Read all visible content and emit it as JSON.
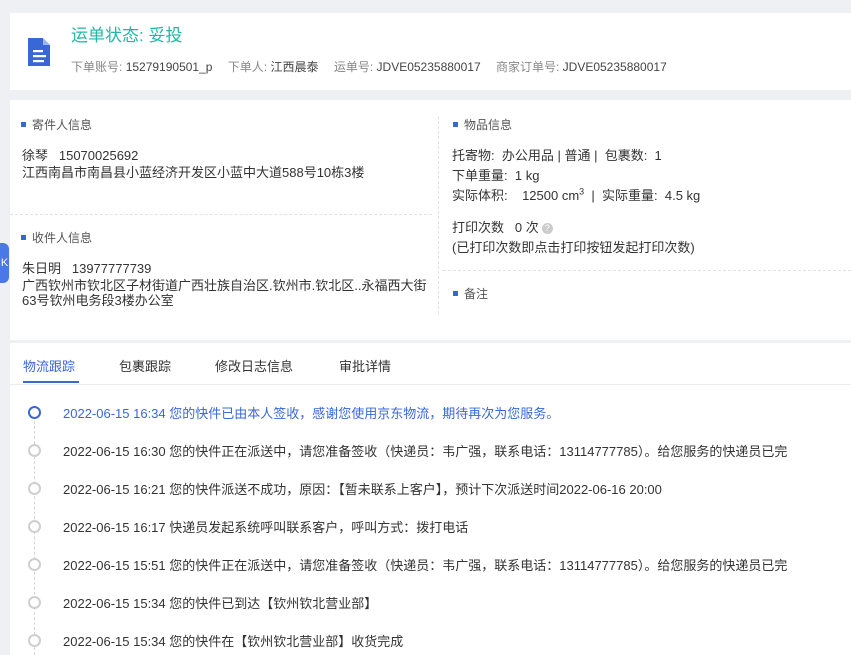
{
  "header": {
    "status": "运单状态: 妥投",
    "account_label": "下单账号:",
    "account_value": "15279190501_p",
    "orderer_label": "下单人:",
    "orderer_value": "江西晨泰",
    "waybill_label": "运单号:",
    "waybill_value": "JDVE05235880017",
    "merchant_label": "商家订单号:",
    "merchant_value": "JDVE05235880017"
  },
  "sender": {
    "title": "寄件人信息",
    "name": "徐琴",
    "phone": "15070025692",
    "address": "江西南昌市南昌县小蓝经济开发区小蓝中大道588号10栋3楼"
  },
  "receiver": {
    "title": "收件人信息",
    "name": "朱日明",
    "phone": "13977777739",
    "address": "广西钦州市钦北区子材街道广西壮族自治区.钦州市.钦北区..永福西大街63号钦州电务段3楼办公室"
  },
  "goods": {
    "title": "物品信息",
    "item_label": "托寄物:",
    "item_value": "办公用品 | 普通",
    "pkg_label": "包裹数:",
    "pkg_value": "1",
    "weight_label": "下单重量:",
    "weight_value": "1 kg",
    "volume_label": "实际体积:",
    "volume_value": "12500 cm",
    "volume_sup": "3",
    "actual_weight_label": "实际重量:",
    "actual_weight_value": "4.5 kg",
    "print_label": "打印次数",
    "print_value": "0 次",
    "print_note": "(已打印次数即点击打印按钮发起打印次数)"
  },
  "remark": {
    "title": "备注"
  },
  "side_tab": {
    "label": "K"
  },
  "tabs": [
    "物流跟踪",
    "包裹跟踪",
    "修改日志信息",
    "审批详情"
  ],
  "timeline": [
    "2022-06-15 16:34 您的快件已由本人签收，感谢您使用京东物流，期待再次为您服务。",
    "2022-06-15 16:30 您的快件正在派送中，请您准备签收（快递员：韦广强，联系电话：13114777785）。给您服务的快递员已完",
    "2022-06-15 16:21 您的快件派送不成功，原因：【暂未联系上客户】，预计下次派送时间2022-06-16 20:00",
    "2022-06-15 16:17 快递员发起系统呼叫联系客户，呼叫方式：拨打电话",
    "2022-06-15 15:51 您的快件正在派送中，请您准备签收（快递员：韦广强，联系电话：13114777785）。给您服务的快递员已完",
    "2022-06-15 15:34 您的快件已到达【钦州钦北营业部】",
    "2022-06-15 15:34 您的快件在【钦州钦北营业部】收货完成"
  ],
  "colors": {
    "accent": "#3a67d8",
    "status": "#1fb8a5"
  }
}
